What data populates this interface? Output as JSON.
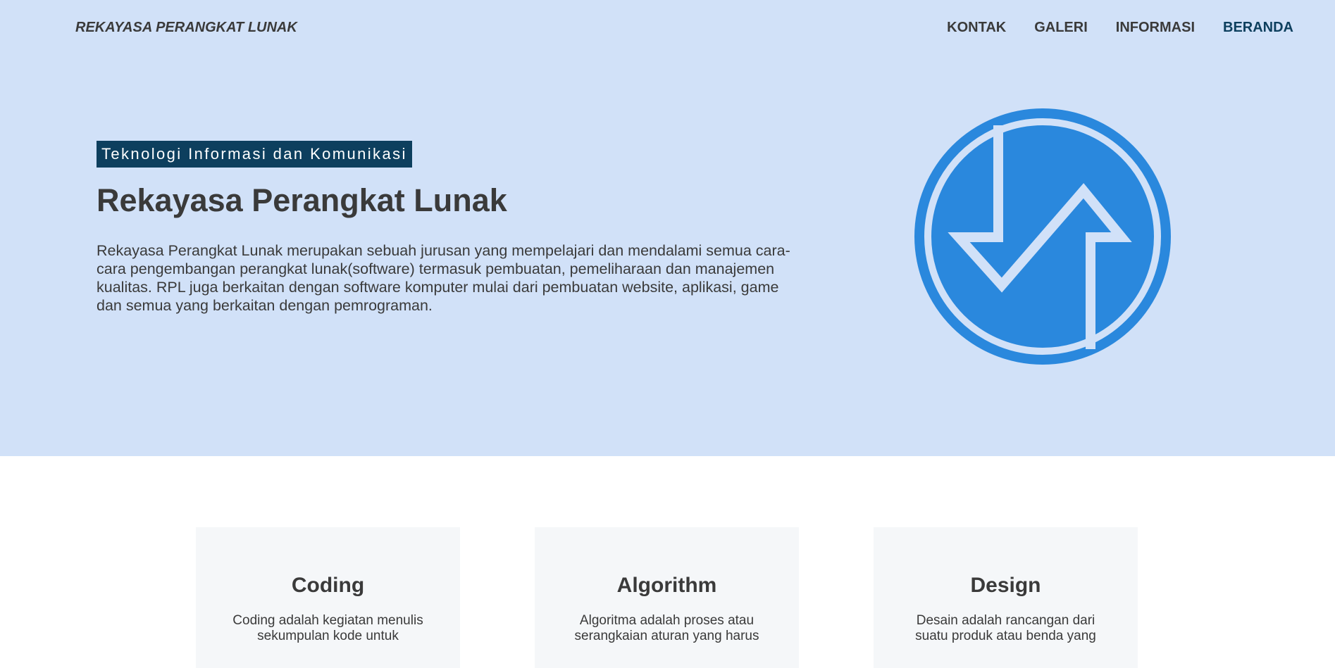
{
  "brand": "REKAYASA PERANGKAT LUNAK",
  "nav": {
    "items": [
      "KONTAK",
      "GALERI",
      "INFORMASI",
      "BERANDA"
    ],
    "active": "BERANDA"
  },
  "hero": {
    "tag": "Teknologi Informasi dan Komunikasi",
    "title": "Rekayasa Perangkat Lunak",
    "description": "Rekayasa Perangkat Lunak merupakan sebuah jurusan yang mempelajari dan mendalami semua cara-cara pengembangan perangkat lunak(software) termasuk pembuatan, pemeliharaan dan manajemen kualitas. RPL juga berkaitan dengan software komputer mulai dari pembuatan website, aplikasi, game dan semua yang berkaitan dengan pemrograman.",
    "logo_icon": "rpl-logo-icon"
  },
  "cards": [
    {
      "title": "Coding",
      "text": "Coding adalah kegiatan menulis sekumpulan kode untuk"
    },
    {
      "title": "Algorithm",
      "text": "Algoritma adalah proses atau serangkaian aturan yang harus"
    },
    {
      "title": "Design",
      "text": "Desain adalah rancangan dari suatu produk atau benda yang"
    }
  ],
  "colors": {
    "hero_bg": "#d1e1f8",
    "accent": "#0d3f5e",
    "logo_blue": "#2a88dd",
    "card_bg": "#f5f7f9",
    "text": "#3a3a3a"
  }
}
